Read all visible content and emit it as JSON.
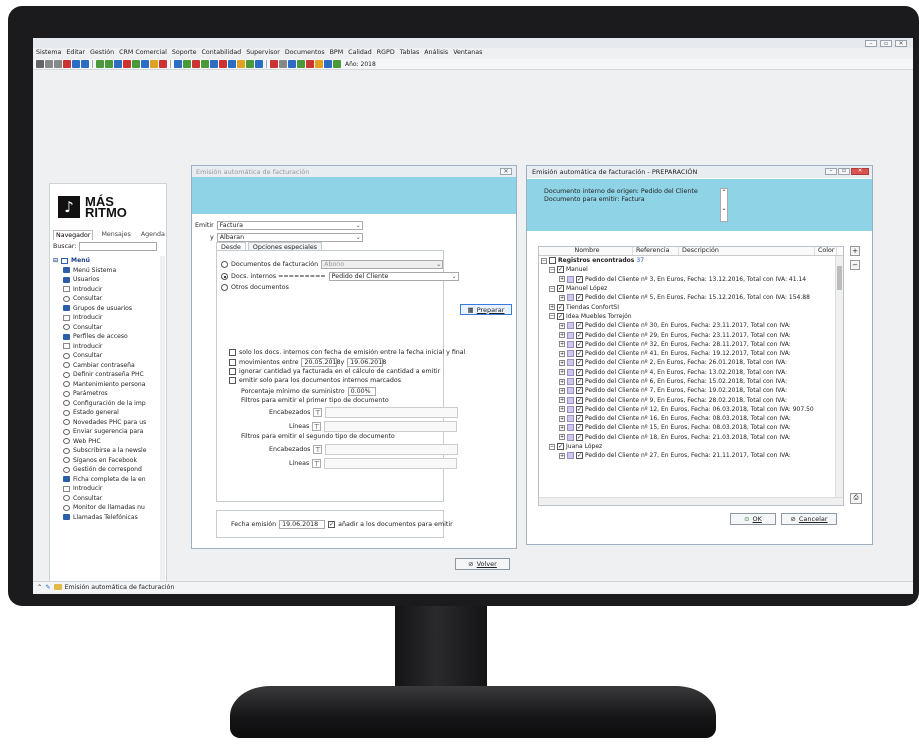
{
  "app": {
    "window_controls": [
      "–",
      "▫",
      "✕"
    ],
    "menu": [
      "Sistema",
      "Editar",
      "Gestión",
      "CRM Comercial",
      "Soporte",
      "Contabilidad",
      "Supervisor",
      "Documentos",
      "BPM",
      "Calidad",
      "RGPD",
      "Tablas",
      "Análisis",
      "Ventanas"
    ],
    "toolbar_year": "Año: 2018",
    "toolbar_colors": [
      "#666",
      "#888",
      "#888",
      "#c33",
      "#2b6cc4",
      "#2b6cc4",
      "#4a9a3a",
      "#4a9a3a",
      "#2b6cc4",
      "#c33",
      "#4a9a3a",
      "#2b6cc4",
      "#e0a020",
      "#c33",
      "#2b6cc4",
      "#4a9a3a",
      "#c33",
      "#4a9a3a",
      "#2b6cc4",
      "#c33",
      "#2b6cc4",
      "#e0a020",
      "#4a9a3a",
      "#2b6cc4",
      "#c33",
      "#888",
      "#2b6cc4",
      "#4a9a3a",
      "#c33",
      "#e0a020",
      "#2b6cc4",
      "#4a9a3a"
    ]
  },
  "logo": {
    "line1": "MÁS",
    "line2": "RITMO"
  },
  "navigator": {
    "tabs": [
      "Navegador",
      "Mensajes",
      "Agenda"
    ],
    "search_label": "Buscar:",
    "root": "Menú",
    "items": [
      {
        "icon": "folder",
        "label": "Menú Sistema"
      },
      {
        "icon": "folder",
        "label": "Usuarios"
      },
      {
        "icon": "doc",
        "label": "Introducir"
      },
      {
        "icon": "circle",
        "label": "Consultar"
      },
      {
        "icon": "folder",
        "label": "Grupos de usuarios"
      },
      {
        "icon": "doc",
        "label": "Introducir"
      },
      {
        "icon": "circle",
        "label": "Consultar"
      },
      {
        "icon": "folder",
        "label": "Perfiles de acceso"
      },
      {
        "icon": "doc",
        "label": "Introducir"
      },
      {
        "icon": "circle",
        "label": "Consultar"
      },
      {
        "icon": "circle",
        "label": "Cambiar contraseña"
      },
      {
        "icon": "circle",
        "label": "Definir contraseña PHC"
      },
      {
        "icon": "circle",
        "label": "Mantenimiento persona"
      },
      {
        "icon": "circle",
        "label": "Parámetros"
      },
      {
        "icon": "circle",
        "label": "Configuración de la imp"
      },
      {
        "icon": "circle",
        "label": "Estado general"
      },
      {
        "icon": "circle",
        "label": "Novedades PHC para us"
      },
      {
        "icon": "circle",
        "label": "Enviar sugerencia para"
      },
      {
        "icon": "circle",
        "label": "Web PHC"
      },
      {
        "icon": "circle",
        "label": "Subscribirse a la newsle"
      },
      {
        "icon": "circle",
        "label": "Síganos en Facebook"
      },
      {
        "icon": "circle",
        "label": "Gestión de correspond"
      },
      {
        "icon": "folder",
        "label": "Ficha completa de la en"
      },
      {
        "icon": "doc",
        "label": "Introducir"
      },
      {
        "icon": "circle",
        "label": "Consultar"
      },
      {
        "icon": "circle",
        "label": "Monitor de llamadas nu"
      },
      {
        "icon": "folder",
        "label": "Llamadas Telefónicas"
      }
    ]
  },
  "dialog1": {
    "title": "Emisión automática de facturación",
    "emitir_label": "Emitir",
    "emitir_value": "Factura",
    "y_label": "y",
    "y_value": "Albaran",
    "tabs": [
      "Desde",
      "Opciones especiales"
    ],
    "preparar": "Preparar",
    "radio_facturacion": "Documentos de facturación",
    "facturacion_value": "Abono",
    "radio_internos": "Docs. internos =========",
    "internos_value": "Pedido del Cliente",
    "radio_otros": "Otros documentos",
    "check1": "solo los docs. internos con fecha de emisión entre la fecha inicial y final",
    "check2_a": "movimientos entre",
    "date_from": "20.05.2018",
    "check2_y": "y",
    "date_to": "19.06.2018",
    "check3": "ignorar cantidad ya facturada en el cálculo de cantidad a emitir",
    "check4": "emitir solo para los documentos internos marcados",
    "pct_label": "Porcentaje mínimo de suministro",
    "pct_value": "0.00%",
    "filter1_title": "Filtros para emitir el primer tipo de documento",
    "filter2_title": "Filtros para emitir el segundo tipo de documento",
    "encabezados": "Encabezados",
    "lineas": "Líneas",
    "fecha_label": "Fecha emisión",
    "fecha_value": "19.06.2018",
    "anadir": "añadir a los documentos para emitir",
    "volver": "Volver"
  },
  "dialog2": {
    "title": "Emisión automática de facturación - PREPARACIÓN",
    "info_line1": "Documento interno de origen: Pedido del Cliente",
    "info_line2": "Documento para emitir: Factura",
    "columns": [
      "Nombre",
      "Referencia",
      "Descripción",
      "Color"
    ],
    "root_label": "Registros encontrados",
    "root_count": "37",
    "rows": [
      {
        "level": 1,
        "label": "Manuel"
      },
      {
        "level": 2,
        "label": "Pedido del Cliente nº 3, En Euros, Fecha: 13.12.2016, Total con IVA: 41.14"
      },
      {
        "level": 1,
        "label": "Manuel López"
      },
      {
        "level": 2,
        "label": "Pedido del Cliente nº 5, En Euros, Fecha: 15.12.2016, Total con IVA: 154.88"
      },
      {
        "level": 1,
        "label": "Tiendas ConfortSI"
      },
      {
        "level": 1,
        "label": "Idea Muebles Torrejón"
      },
      {
        "level": 2,
        "label": "Pedido del Cliente nº 30, En Euros, Fecha: 23.11.2017, Total con IVA:"
      },
      {
        "level": 2,
        "label": "Pedido del Cliente nº 29, En Euros, Fecha: 23.11.2017, Total con IVA:"
      },
      {
        "level": 2,
        "label": "Pedido del Cliente nº 32, En Euros, Fecha: 28.11.2017, Total con IVA:"
      },
      {
        "level": 2,
        "label": "Pedido del Cliente nº 41, En Euros, Fecha: 19.12.2017, Total con IVA:"
      },
      {
        "level": 2,
        "label": "Pedido del Cliente nº 2, En Euros, Fecha: 26.01.2018, Total con IVA:"
      },
      {
        "level": 2,
        "label": "Pedido del Cliente nº 4, En Euros, Fecha: 13.02.2018, Total con IVA:"
      },
      {
        "level": 2,
        "label": "Pedido del Cliente nº 6, En Euros, Fecha: 15.02.2018, Total con IVA:"
      },
      {
        "level": 2,
        "label": "Pedido del Cliente nº 7, En Euros, Fecha: 19.02.2018, Total con IVA:"
      },
      {
        "level": 2,
        "label": "Pedido del Cliente nº 9, En Euros, Fecha: 28.02.2018, Total con IVA:"
      },
      {
        "level": 2,
        "label": "Pedido del Cliente nº 12, En Euros, Fecha: 06.03.2018, Total con IVA: 907.50"
      },
      {
        "level": 2,
        "label": "Pedido del Cliente nº 16, En Euros, Fecha: 08.03.2018, Total con IVA:"
      },
      {
        "level": 2,
        "label": "Pedido del Cliente nº 15, En Euros, Fecha: 08.03.2018, Total con IVA:"
      },
      {
        "level": 2,
        "label": "Pedido del Cliente nº 18, En Euros, Fecha: 21.03.2018, Total con IVA:"
      },
      {
        "level": 1,
        "label": "Juana López"
      },
      {
        "level": 2,
        "label": "Pedido del Cliente nº 27, En Euros, Fecha: 21.11.2017, Total con IVA:"
      }
    ],
    "ok": "OK",
    "cancel": "Cancelar"
  },
  "statusbar": {
    "task": "Emisión automática de facturación"
  }
}
